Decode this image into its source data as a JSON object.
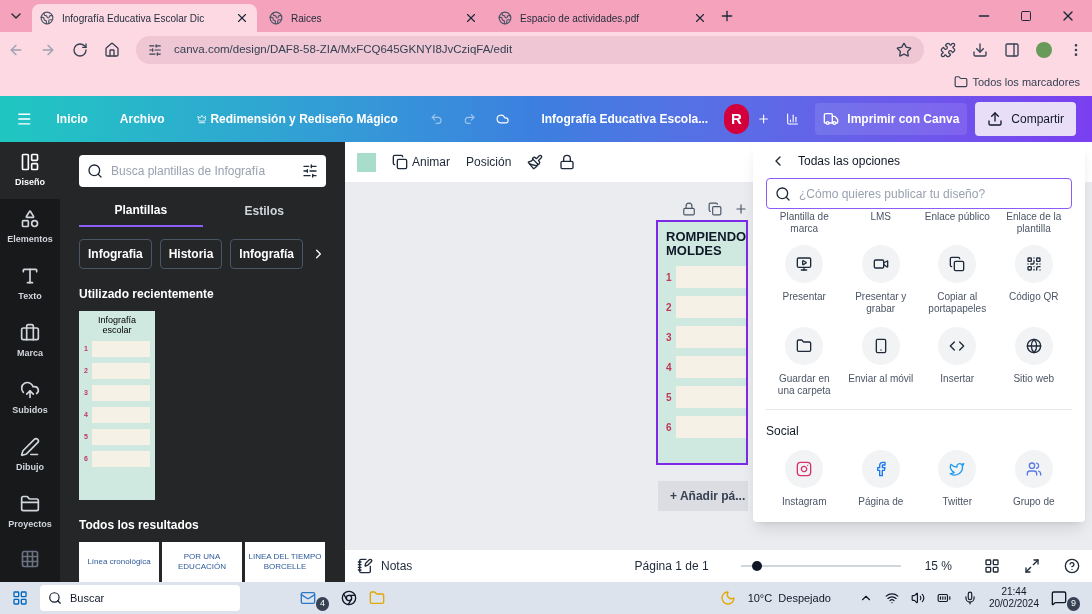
{
  "browser": {
    "tabs": [
      {
        "title": "Infografía Educativa Escolar Dic",
        "selected": true
      },
      {
        "title": "Raices",
        "selected": false
      },
      {
        "title": "Espacio de actividades.pdf",
        "selected": false
      }
    ],
    "url": "canva.com/design/DAF8-58-ZIA/MxFCQ645GKNYI8JvCziqFA/edit",
    "bookmarks": "Todos los marcadores"
  },
  "header": {
    "menu": [
      "Inicio",
      "Archivo",
      "Redimensión y Rediseño Mágico"
    ],
    "doc_title": "Infografía Educativa Escola...",
    "avatar": "R",
    "print_button": "Imprimir con Canva",
    "share_button": "Compartir"
  },
  "rail": [
    {
      "kind": "design",
      "label": "Diseño",
      "selected": true
    },
    {
      "kind": "elements",
      "label": "Elementos",
      "selected": false
    },
    {
      "kind": "text",
      "label": "Texto",
      "selected": false
    },
    {
      "kind": "brand",
      "label": "Marca",
      "selected": false
    },
    {
      "kind": "uploads",
      "label": "Subidos",
      "selected": false
    },
    {
      "kind": "draw",
      "label": "Dibujo",
      "selected": false
    },
    {
      "kind": "projects",
      "label": "Proyectos",
      "selected": false
    }
  ],
  "panel": {
    "search_placeholder": "Busca plantillas de Infografía",
    "tabs": [
      {
        "label": "Plantillas",
        "selected": true
      },
      {
        "label": "Estilos",
        "selected": false
      }
    ],
    "chips": [
      "Infografia",
      "Historia",
      "Infografía"
    ],
    "recent_heading": "Utilizado recientemente",
    "recent_template": {
      "title": "Infografía escolar",
      "numbers": [
        "1",
        "2",
        "3",
        "4",
        "5",
        "6"
      ]
    },
    "results_heading": "Todos los resultados",
    "results": [
      {
        "lines": [
          "Línea cronológica"
        ]
      },
      {
        "lines": [
          "POR UNA",
          "EDUCACIÓN"
        ]
      },
      {
        "lines": [
          "LINEA DEL TIEMPO",
          "BORCELLE"
        ]
      }
    ]
  },
  "toolbar": {
    "animate": "Animar",
    "position": "Posición"
  },
  "canvas": {
    "design_title": "ROMPIENDO MOLDES",
    "numbers": [
      "1",
      "2",
      "3",
      "4",
      "5",
      "6"
    ],
    "add_page": "+ Añadir pá..."
  },
  "share": {
    "title": "Todas las opciones",
    "search_placeholder": "¿Cómo quieres publicar tu diseño?",
    "cut_row": [
      "Plantilla de marca",
      "LMS",
      "Enlace público",
      "Enlace de la plantilla"
    ],
    "options": [
      {
        "kind": "present",
        "label": "Presentar"
      },
      {
        "kind": "record",
        "label": "Presentar y grabar"
      },
      {
        "kind": "copy",
        "label": "Copiar al portapapeles"
      },
      {
        "kind": "qr",
        "label": "Código QR"
      },
      {
        "kind": "folder",
        "label": "Guardar en una carpeta"
      },
      {
        "kind": "phone",
        "label": "Enviar al móvil"
      },
      {
        "kind": "embed",
        "label": "Insertar"
      },
      {
        "kind": "website",
        "label": "Sitio web"
      }
    ],
    "social_heading": "Social",
    "social": [
      {
        "kind": "instagram",
        "label": "Instagram"
      },
      {
        "kind": "facebook",
        "label": "Página de"
      },
      {
        "kind": "twitter",
        "label": "Twitter"
      },
      {
        "kind": "group",
        "label": "Grupo de"
      }
    ]
  },
  "footer": {
    "notes": "Notas",
    "page": "Página 1 de 1",
    "zoom": {
      "level": 0.1
    },
    "zoom_reading": "15 %"
  },
  "taskbar": {
    "search": "Buscar",
    "mail_count": "4",
    "weather": "10°C  Despejado",
    "time": "21:44",
    "date": "20/02/2024",
    "notifications": "9"
  }
}
